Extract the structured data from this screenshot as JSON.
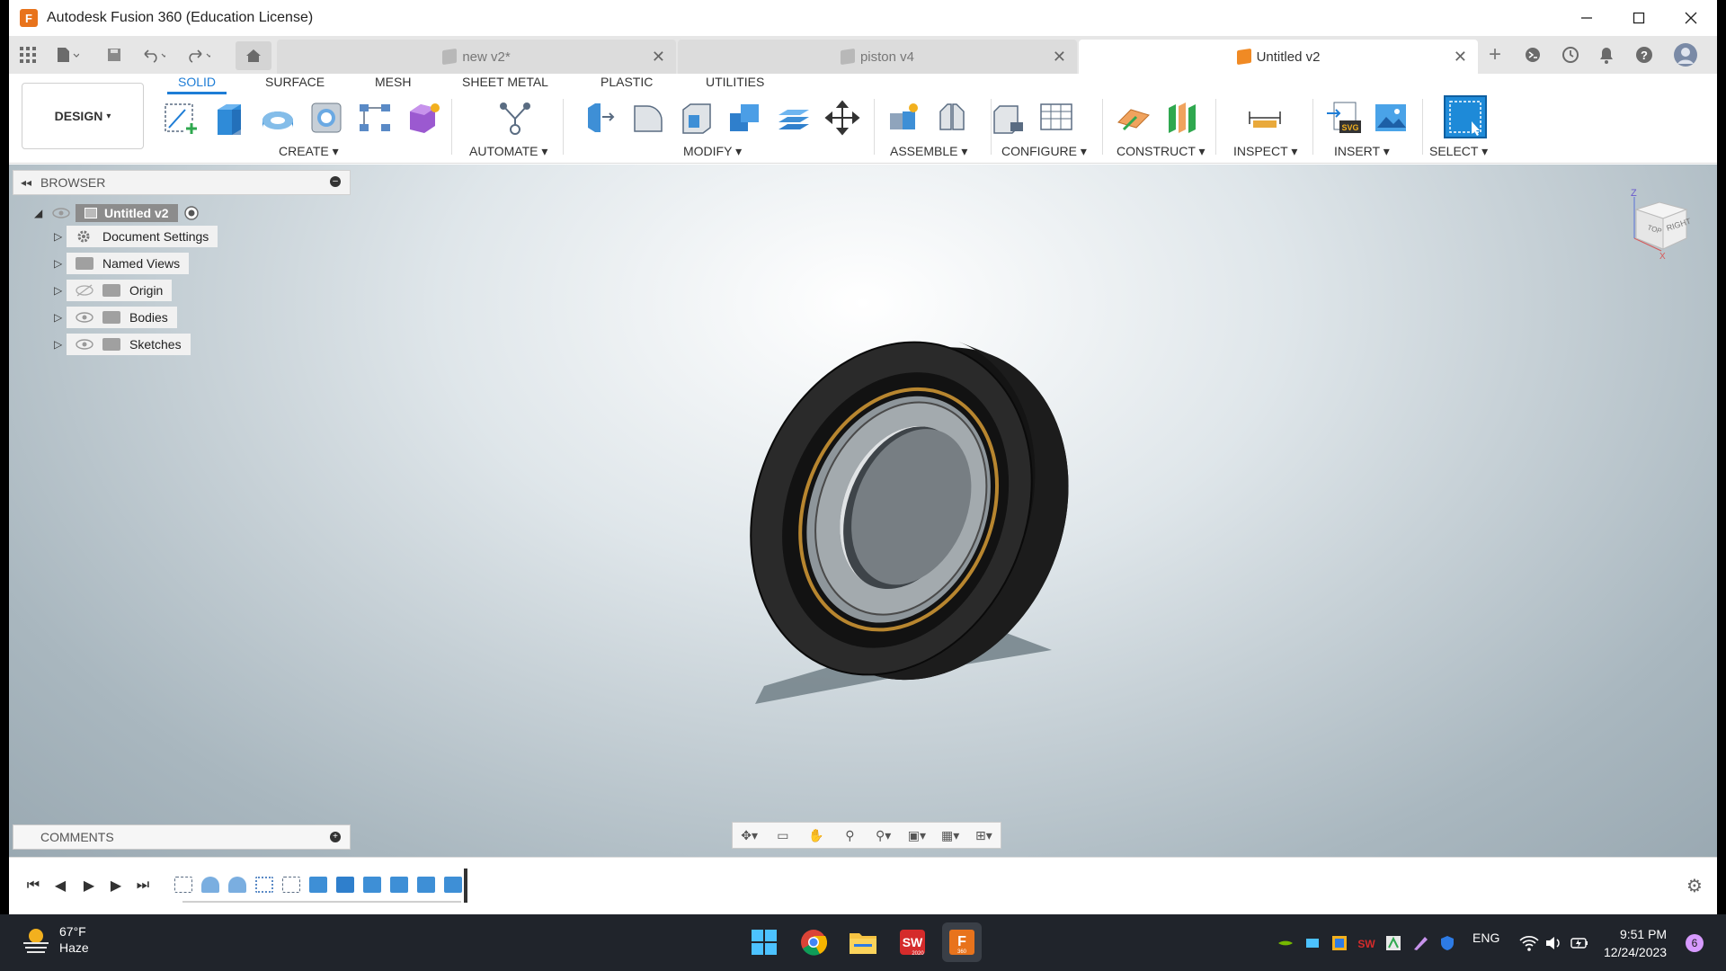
{
  "window": {
    "title": "Autodesk Fusion 360 (Education License)",
    "controls": [
      "minimize",
      "maximize",
      "close"
    ]
  },
  "tabs": [
    {
      "label": "new v2*",
      "active": false
    },
    {
      "label": "piston v4",
      "active": false
    },
    {
      "label": "Untitled v2",
      "active": true
    }
  ],
  "toolbar": {
    "workspace": "DESIGN",
    "workspace_tabs": [
      "SOLID",
      "SURFACE",
      "MESH",
      "SHEET METAL",
      "PLASTIC",
      "UTILITIES"
    ],
    "active_tab": "SOLID",
    "groups": [
      "CREATE",
      "AUTOMATE",
      "MODIFY",
      "ASSEMBLE",
      "CONFIGURE",
      "CONSTRUCT",
      "INSPECT",
      "INSERT",
      "SELECT"
    ]
  },
  "browser": {
    "header": "BROWSER",
    "root": "Untitled v2",
    "items": [
      "Document Settings",
      "Named Views",
      "Origin",
      "Bodies",
      "Sketches"
    ]
  },
  "comments": {
    "label": "COMMENTS"
  },
  "viewcube": {
    "top": "TOP",
    "right": "RIGHT",
    "axis_z": "Z",
    "axis_x": "X"
  },
  "taskbar": {
    "temperature": "67°F",
    "weather": "Haze",
    "language": "ENG",
    "time": "9:51 PM",
    "date": "12/24/2023",
    "notification_count": "6",
    "solidworks_year": "2020",
    "fusion_badge": "360"
  },
  "colors": {
    "accent": "#1e7dd6",
    "fusion_orange": "#e8731c",
    "taskbar": "#20242b"
  }
}
